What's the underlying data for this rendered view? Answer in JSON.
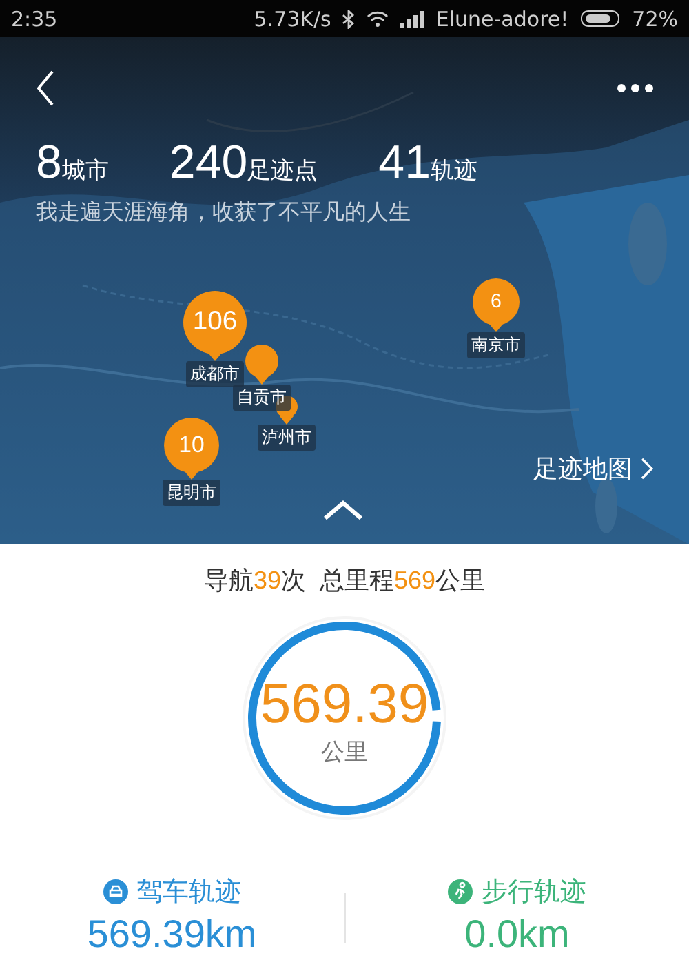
{
  "status_bar": {
    "time": "2:35",
    "speed": "5.73K/s",
    "carrier": "Elune-adore!",
    "battery": "72%"
  },
  "stats": [
    {
      "value": "8",
      "unit": "城市"
    },
    {
      "value": "240",
      "unit": "足迹点"
    },
    {
      "value": "41",
      "unit": "轨迹"
    }
  ],
  "slogan": "我走遍天涯海角，收获了不平凡的人生",
  "markers": [
    {
      "count": "10",
      "label": "昆明市"
    },
    {
      "label": "泸州市"
    },
    {
      "label": "自贡市"
    },
    {
      "count": "106",
      "label": "成都市"
    },
    {
      "count": "6",
      "label": "南京市"
    }
  ],
  "map_link": "足迹地图",
  "summary": [
    {
      "text": "导航",
      "highlight": false
    },
    {
      "text": "39",
      "highlight": true
    },
    {
      "text": "次",
      "highlight": false
    },
    {
      "text": "总里程",
      "highlight": false
    },
    {
      "text": "569",
      "highlight": true
    },
    {
      "text": "公里",
      "highlight": false
    }
  ],
  "ring": {
    "value": "569.39",
    "unit": "公里",
    "level": 0.98
  },
  "tracks": [
    {
      "kind": "drive",
      "label": "驾车轨迹",
      "value": "569.39km"
    },
    {
      "kind": "walk",
      "label": "步行轨迹",
      "value": "0.0km"
    }
  ]
}
